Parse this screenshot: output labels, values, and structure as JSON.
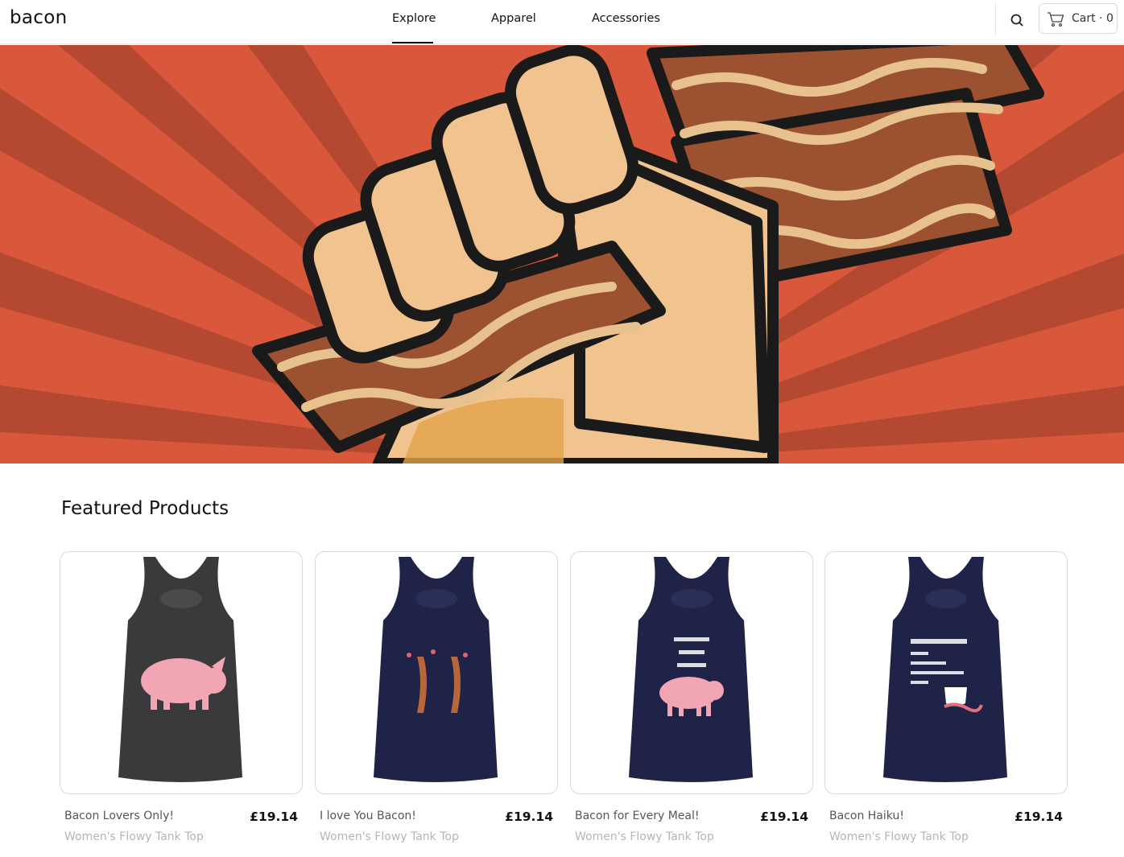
{
  "header": {
    "brand": "bacon",
    "nav": [
      {
        "label": "Explore",
        "active": true
      },
      {
        "label": "Apparel",
        "active": false
      },
      {
        "label": "Accessories",
        "active": false
      }
    ],
    "cart_label": "Cart · 0",
    "icons": {
      "search": "search-icon",
      "cart": "cart-icon"
    }
  },
  "hero": {
    "description_icon": "bacon-fist-banner"
  },
  "featured": {
    "title": "Featured Products",
    "products": [
      {
        "name": "Bacon Lovers Only!",
        "price": "£19.14",
        "type": "Women's Flowy Tank Top",
        "color": "#3a3a3c"
      },
      {
        "name": "I love You Bacon!",
        "price": "£19.14",
        "type": "Women's Flowy Tank Top",
        "color": "#1f2347"
      },
      {
        "name": "Bacon for Every Meal!",
        "price": "£19.14",
        "type": "Women's Flowy Tank Top",
        "color": "#1f2347"
      },
      {
        "name": "Bacon Haiku!",
        "price": "£19.14",
        "type": "Women's Flowy Tank Top",
        "color": "#1f2347"
      }
    ]
  },
  "colors": {
    "hero_bg": "#d9573a",
    "hero_ray": "#a8442e",
    "skin": "#f0c38f",
    "bacon_dark": "#9c5230",
    "bacon_light": "#e8c28e"
  }
}
